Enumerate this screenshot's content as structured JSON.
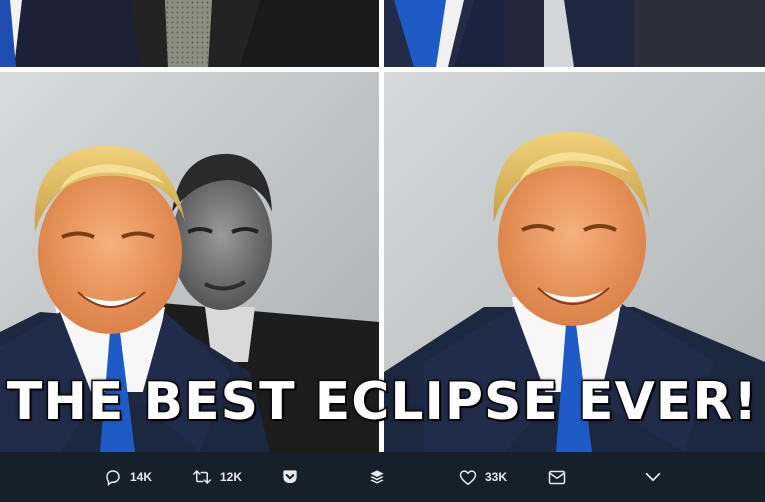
{
  "meme": {
    "caption": "THE BEST ECLIPSE EVER!"
  },
  "tweet_actions": {
    "reply": {
      "icon": "reply-icon",
      "count": "14K"
    },
    "retweet": {
      "icon": "retweet-icon",
      "count": "12K"
    },
    "pocket": {
      "icon": "pocket-icon"
    },
    "buffer": {
      "icon": "buffer-icon"
    },
    "like": {
      "icon": "heart-icon",
      "count": "33K"
    },
    "message": {
      "icon": "envelope-icon"
    },
    "more": {
      "icon": "chevron-down-icon"
    }
  },
  "colors": {
    "action_bar_bg": "#15202b",
    "action_text": "#e7e9ea",
    "caption_fill": "#ffffff",
    "caption_stroke": "#111111",
    "suit_navy": "#1c2740",
    "tie_blue": "#1e5bc6"
  }
}
